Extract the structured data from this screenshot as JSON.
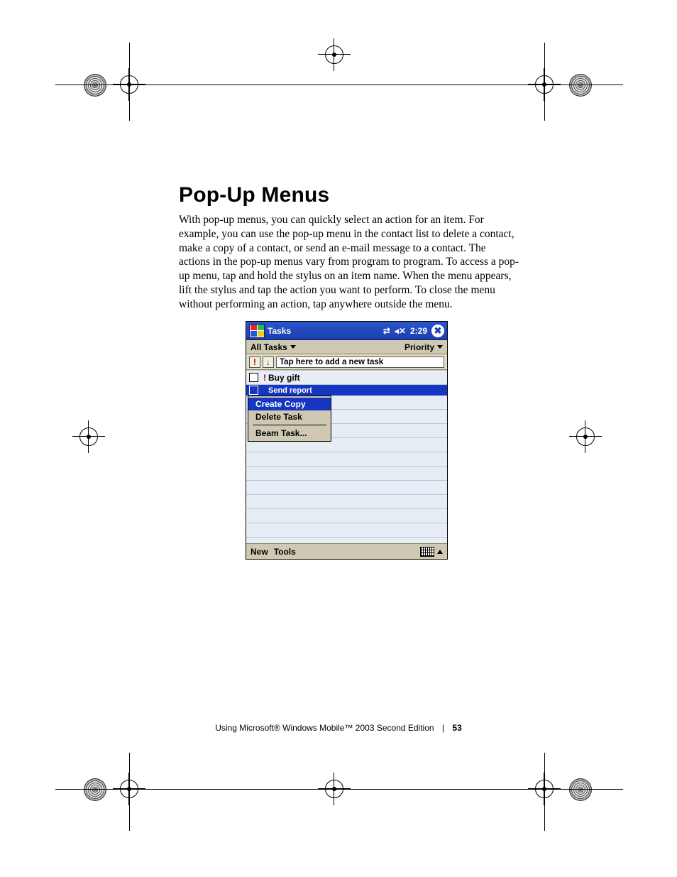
{
  "heading": "Pop-Up Menus",
  "paragraph": "With pop-up menus, you can quickly select an action for an item. For example, you can use the pop-up menu in the contact list to delete a contact, make a copy of a contact, or send an e-mail message to a contact. The actions in the pop-up menus vary from program to program. To access a pop-up menu, tap and hold the stylus on an item name. When the menu appears, lift the stylus and tap the action you want to perform. To close the menu without performing an action, tap anywhere outside the menu.",
  "pda": {
    "titlebar": {
      "app": "Tasks",
      "time": "2:29"
    },
    "filter": {
      "left": "All Tasks",
      "right": "Priority"
    },
    "addRow": {
      "placeholder": "Tap here to add a new task"
    },
    "tasks": {
      "t1": "Buy gift",
      "t2": "Send report"
    },
    "popup": {
      "m1": "Create Copy",
      "m2": "Delete Task",
      "m3": "Beam Task..."
    },
    "bottom": {
      "b1": "New",
      "b2": "Tools"
    }
  },
  "footer": {
    "text": "Using Microsoft® Windows Mobile™ 2003 Second Edition",
    "page": "53"
  }
}
